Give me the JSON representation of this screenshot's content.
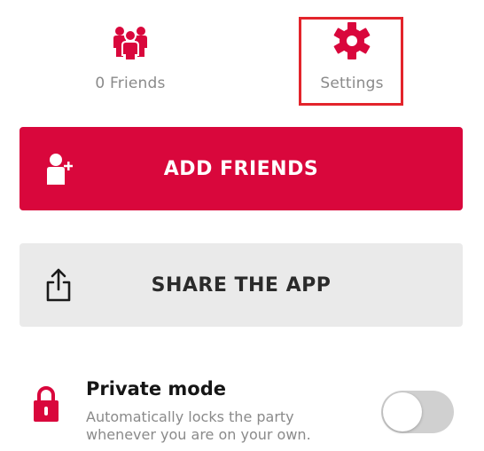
{
  "colors": {
    "brand": "#d9073c",
    "highlight": "#e3242b",
    "muted_text": "#8a8a8a",
    "share_bg": "#eaeaea",
    "toggle_off": "#d0d0d0"
  },
  "nav": {
    "friends": {
      "icon": "people-icon",
      "label": "0 Friends"
    },
    "settings": {
      "icon": "gear-icon",
      "label": "Settings"
    }
  },
  "buttons": {
    "add_friends": {
      "icon": "add-user-icon",
      "label": "ADD FRIENDS"
    },
    "share_app": {
      "icon": "share-icon",
      "label": "SHARE THE APP"
    }
  },
  "private_mode": {
    "icon": "lock-icon",
    "title": "Private mode",
    "description": "Automatically locks the party whenever you are on your own.",
    "enabled": false
  }
}
